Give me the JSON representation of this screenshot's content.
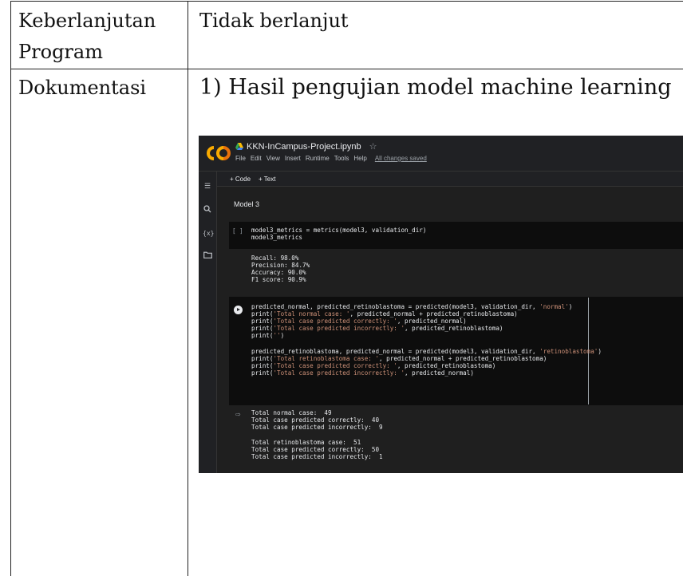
{
  "table": {
    "row1_label_line1": "Keberlanjutan",
    "row1_label_line2": "Program",
    "row1_value": "Tidak berlanjut",
    "row2_label": "Dokumentasi",
    "row2_value": "1) Hasil pengujian model machine learning"
  },
  "colab": {
    "notebook_title": "KKN-InCampus-Project.ipynb",
    "menu": [
      "File",
      "Edit",
      "View",
      "Insert",
      "Runtime",
      "Tools",
      "Help"
    ],
    "save_status": "All changes saved",
    "toolbar": {
      "code": "+ Code",
      "text": "+ Text"
    },
    "rail_icons": [
      "menu-icon",
      "search-icon",
      "variables-icon",
      "folder-icon"
    ],
    "section_heading": "Model 3",
    "cell1": {
      "bracket": "[ ]",
      "line1": "model3_metrics = metrics(model3, validation_dir)",
      "line2": "model3_metrics"
    },
    "cell1_output": {
      "line1": "Recall: 98.0%",
      "line2": "Precision: 84.7%",
      "line3": "Accuracy: 90.0%",
      "line4": "F1 score: 90.9%"
    },
    "cell2": {
      "l1a": "predicted_normal, predicted_retinoblastoma = predicted(model3, validation_dir, ",
      "l1b": "'normal'",
      "l1c": ")",
      "l2a": "print(",
      "l2b": "'Total normal case: '",
      "l2c": ", predicted_normal + predicted_retinoblastoma)",
      "l3a": "print(",
      "l3b": "'Total case predicted correctly: '",
      "l3c": ", predicted_normal)",
      "l4a": "print(",
      "l4b": "'Total case predicted incorrectly: '",
      "l4c": ", predicted_retinoblastoma)",
      "l5a": "print(",
      "l5b": "''",
      "l5c": ")",
      "l6a": "predicted_retinoblastoma, predicted_normal = predicted(model3, validation_dir, ",
      "l6b": "'retinoblastoma'",
      "l6c": ")",
      "l7a": "print(",
      "l7b": "'Total retinoblastoma case: '",
      "l7c": ", predicted_normal + predicted_retinoblastoma)",
      "l8a": "print(",
      "l8b": "'Total case predicted correctly: '",
      "l8c": ", predicted_retinoblastoma)",
      "l9a": "print(",
      "l9b": "'Total case predicted incorrectly: '",
      "l9c": ", predicted_normal)"
    },
    "cell2_output": {
      "line1": "Total normal case:  49",
      "line2": "Total case predicted correctly:  40",
      "line3": "Total case predicted incorrectly:  9",
      "line4": "Total retinoblastoma case:  51",
      "line5": "Total case predicted correctly:  50",
      "line6": "Total case predicted incorrectly:  1"
    },
    "colors": {
      "background": "#1f1f1f",
      "code_bg": "#0d0d0d",
      "string": "#ce9178",
      "logo_orange": "#f9ab00"
    }
  }
}
